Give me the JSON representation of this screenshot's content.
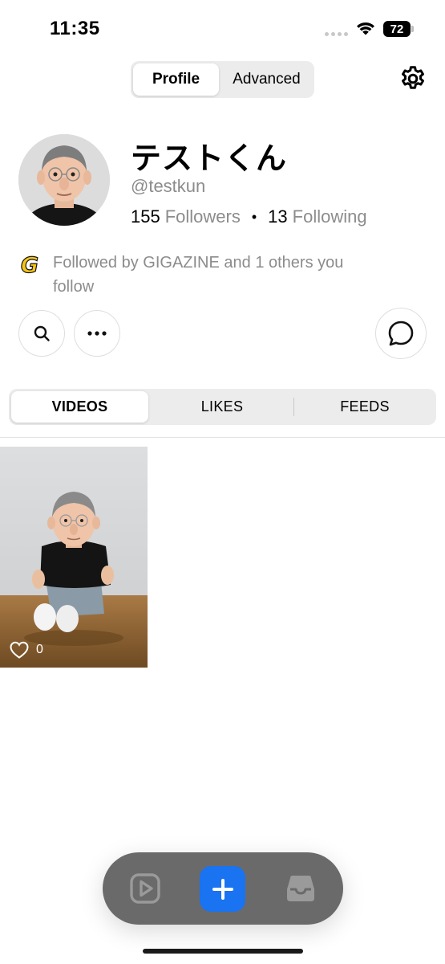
{
  "status_bar": {
    "time": "11:35",
    "battery": "72"
  },
  "header": {
    "tabs": [
      {
        "label": "Profile",
        "active": true
      },
      {
        "label": "Advanced",
        "active": false
      }
    ],
    "settings_icon": "gear-icon"
  },
  "profile": {
    "display_name": "テストくん",
    "handle": "@testkun",
    "followers_count": "155",
    "followers_label": "Followers",
    "following_count": "13",
    "following_label": "Following",
    "separator": "•",
    "followed_by_text": "Followed by GIGAZINE and 1 others you follow",
    "followed_by_logo": "G"
  },
  "actions": {
    "search_icon": "search-icon",
    "more_icon": "more-icon",
    "message_icon": "message-bubble-icon"
  },
  "content_tabs": [
    {
      "label": "VIDEOS",
      "active": true
    },
    {
      "label": "LIKES",
      "active": false
    },
    {
      "label": "FEEDS",
      "active": false
    }
  ],
  "videos": [
    {
      "likes": "0"
    }
  ],
  "bottom_nav": {
    "items": [
      "play-icon",
      "add-icon",
      "inbox-icon"
    ]
  },
  "colors": {
    "accent": "#1a73f0",
    "muted_text": "#8c8c8c",
    "nav_background": "#6a6a6a",
    "logo_yellow": "#f5c518"
  }
}
